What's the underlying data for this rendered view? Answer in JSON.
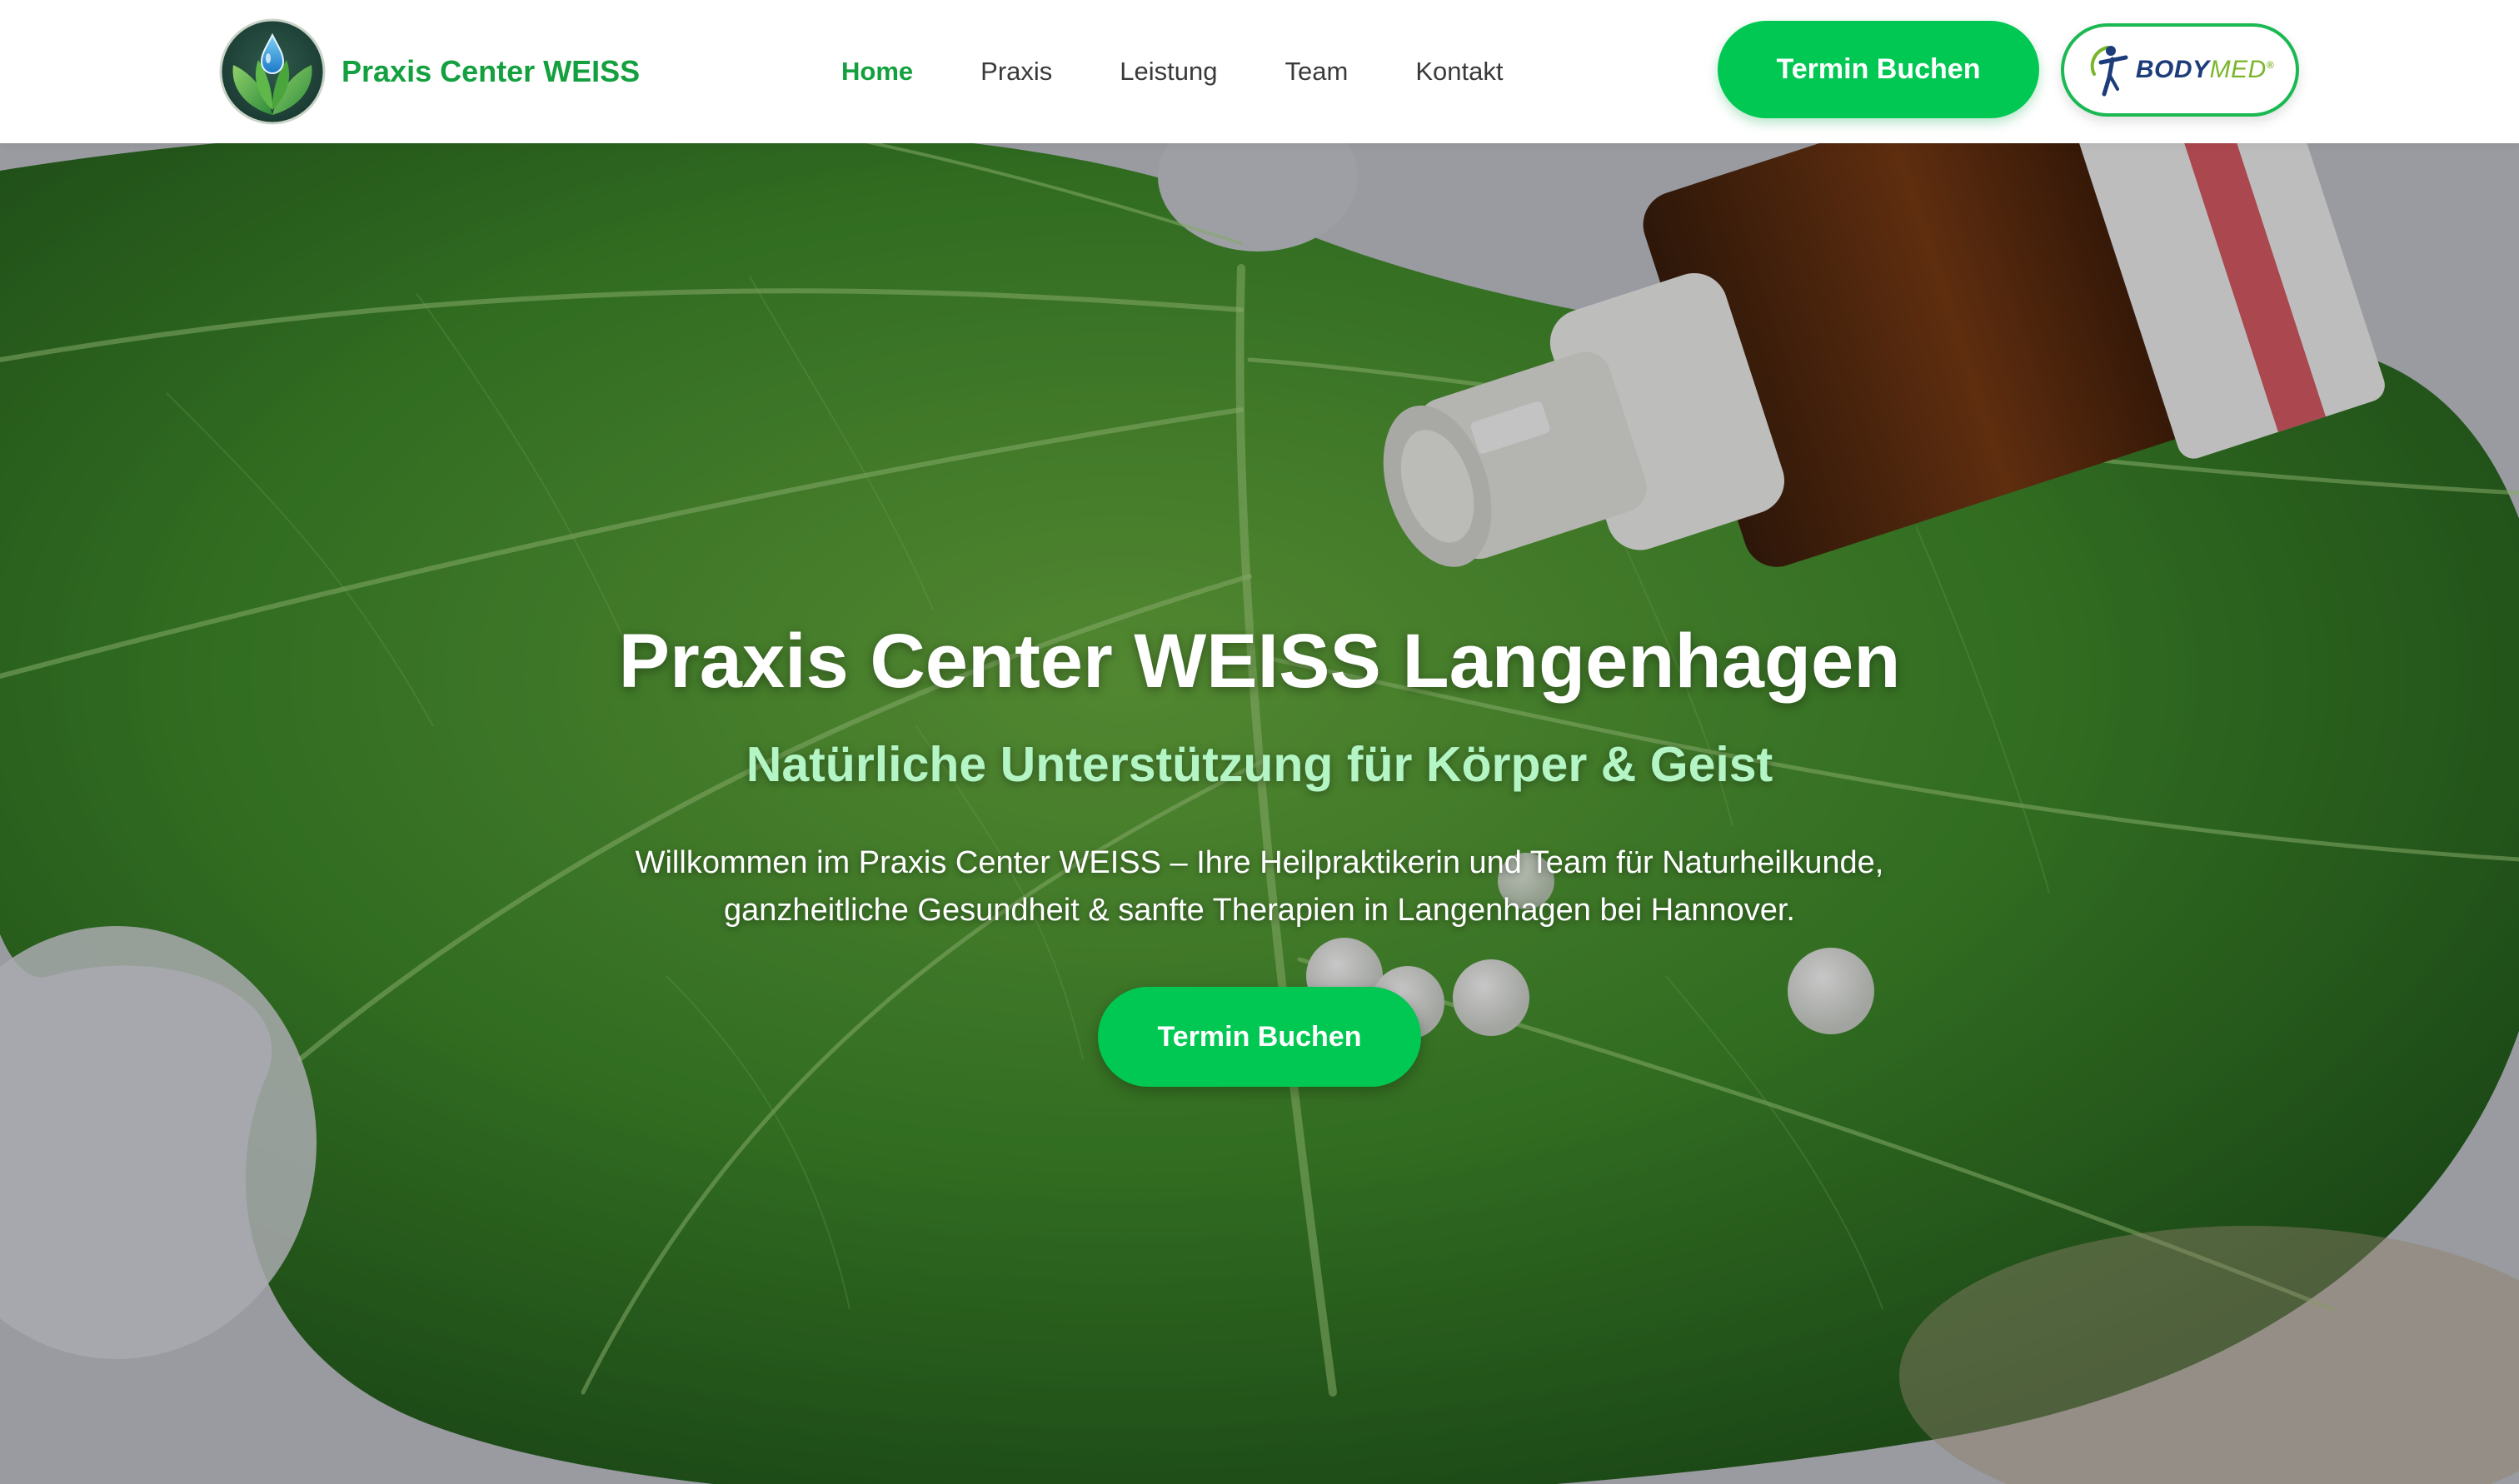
{
  "brand": {
    "name": "Praxis Center WEISS",
    "color": "#14a03f"
  },
  "nav": {
    "items": [
      {
        "label": "Home",
        "active": true
      },
      {
        "label": "Praxis",
        "active": false
      },
      {
        "label": "Leistung",
        "active": false
      },
      {
        "label": "Team",
        "active": false
      },
      {
        "label": "Kontakt",
        "active": false
      }
    ]
  },
  "header": {
    "cta_label": "Termin Buchen",
    "partner_logo": {
      "word_body": "BODY",
      "word_med": "MED",
      "mark": "®"
    }
  },
  "hero": {
    "title": "Praxis Center WEISS Langenhagen",
    "subtitle": "Natürliche Unterstützung für Körper & Geist",
    "text_line1": "Willkommen im Praxis Center WEISS – Ihre Heilpraktikerin und Team für Naturheilkunde,",
    "text_line2": "ganzheitliche Gesundheit & sanfte Therapien in Langenhagen bei Hannover.",
    "cta_label": "Termin Buchen"
  },
  "colors": {
    "accent": "#00c853",
    "subtitle": "#b4f5c6",
    "nav_active": "#14a03f"
  },
  "icons": {
    "logo": "leaf-drop-logo-icon",
    "partner": "bodymed-figure-icon"
  }
}
